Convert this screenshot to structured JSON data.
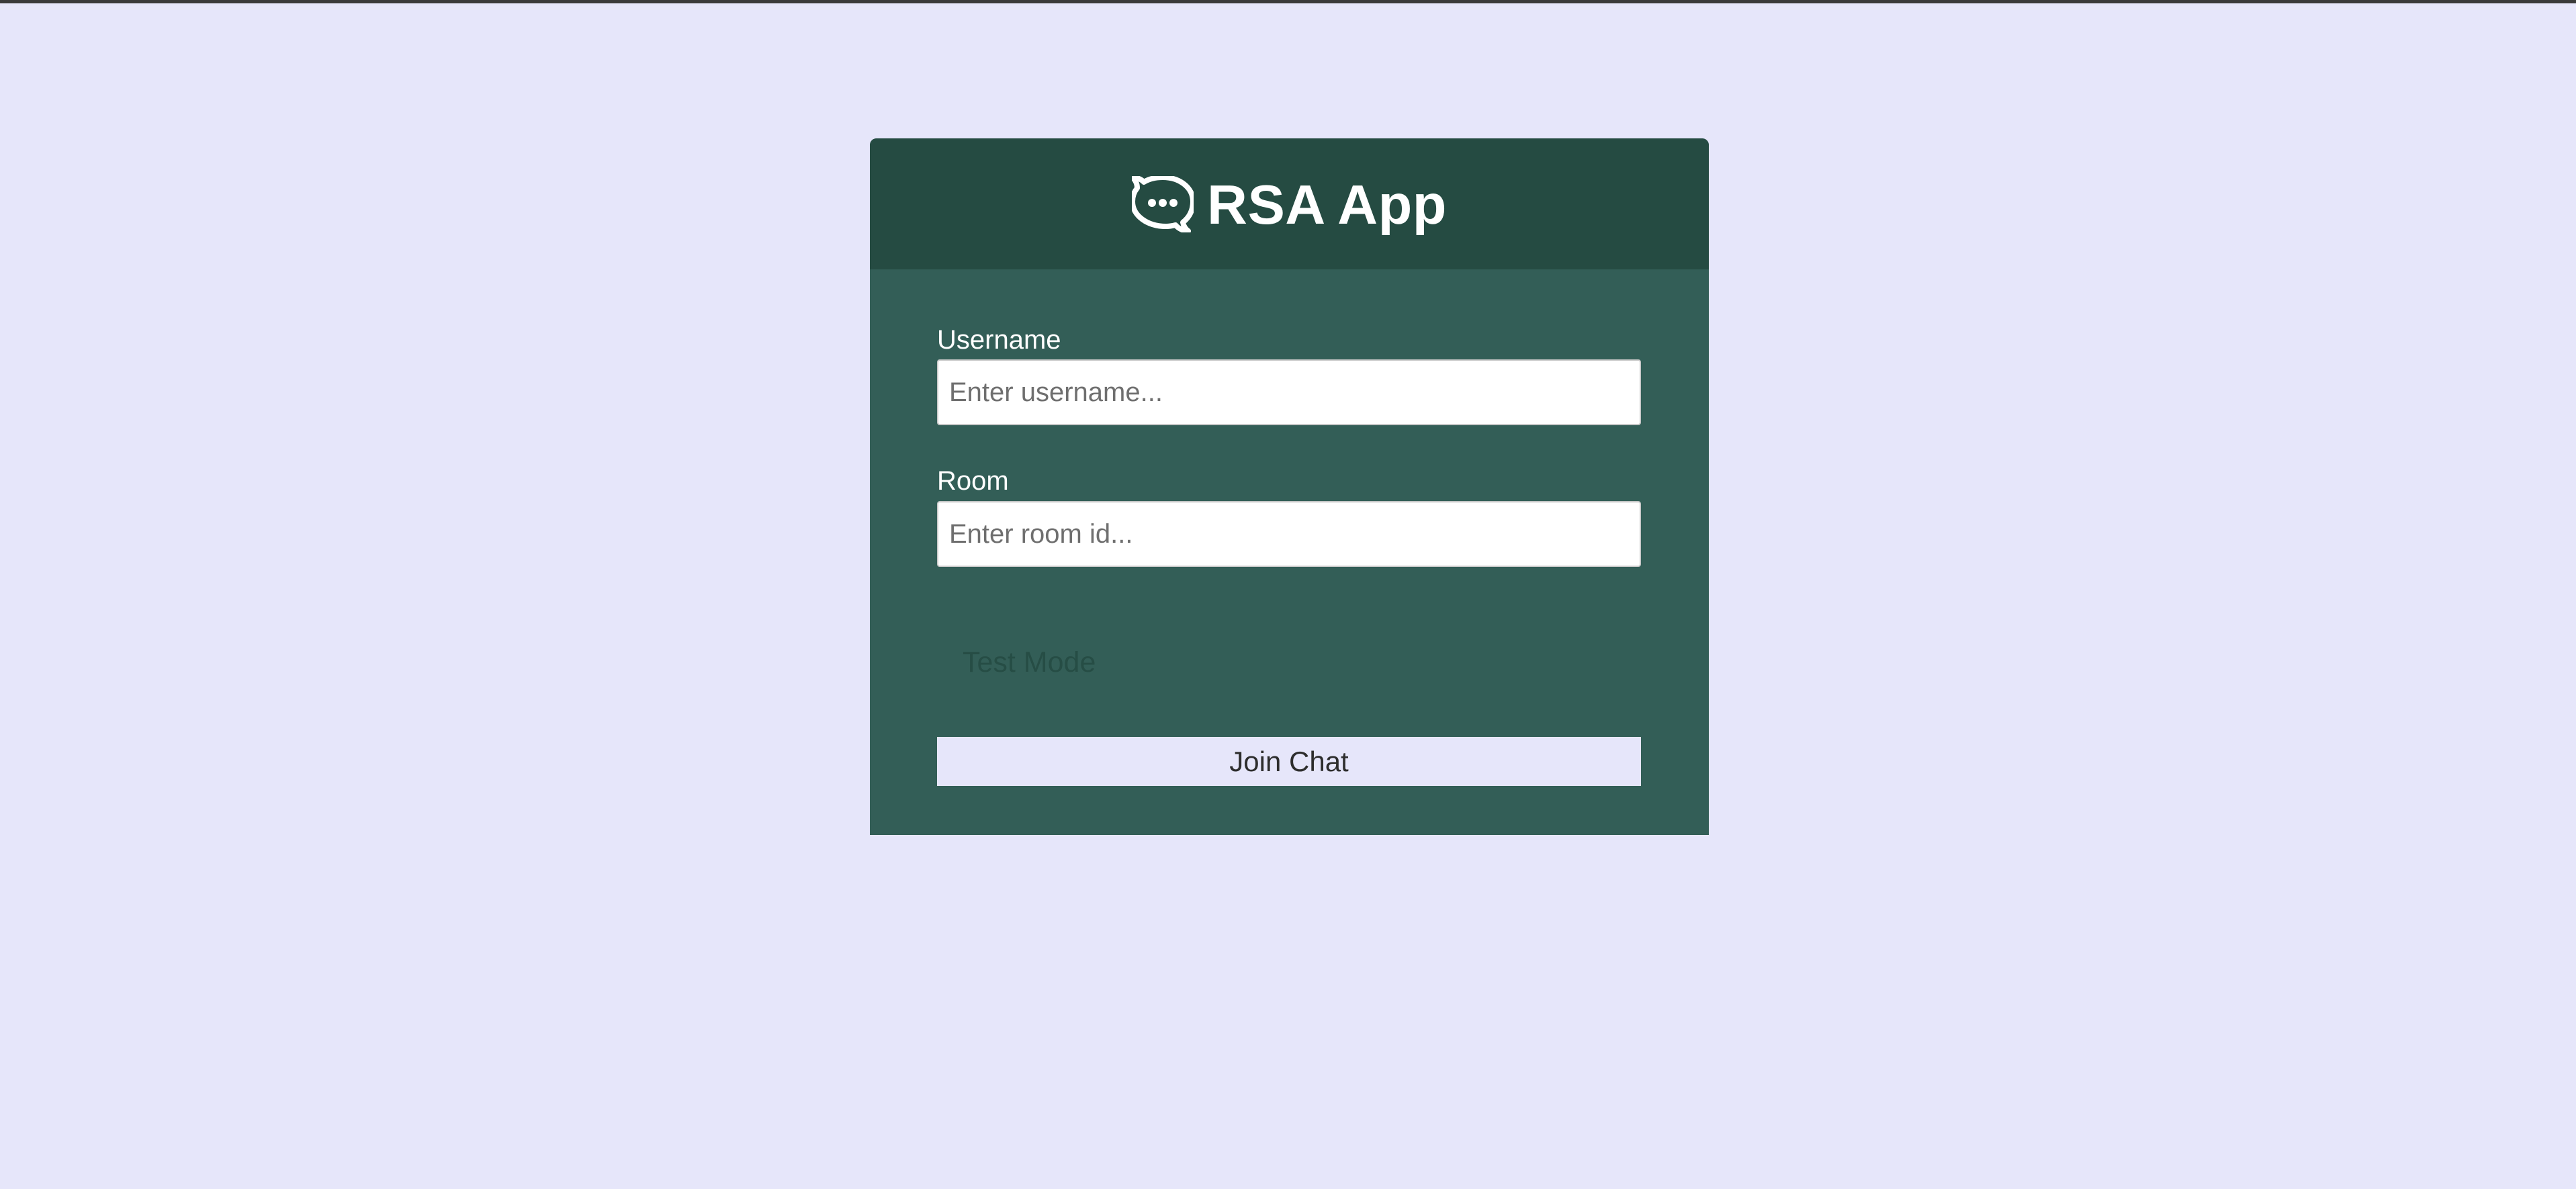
{
  "header": {
    "logo_icon": "chat-bubble-icon",
    "title": "RSA App"
  },
  "form": {
    "username": {
      "label": "Username",
      "placeholder": "Enter username..."
    },
    "room": {
      "label": "Room",
      "placeholder": "Enter room id..."
    },
    "test_mode_label": "Test Mode",
    "join_button_label": "Join Chat"
  },
  "colors": {
    "page_background": "#e6e6fa",
    "card_header": "#254b42",
    "card_body": "#335e57",
    "button_background": "#e6e6fa"
  }
}
